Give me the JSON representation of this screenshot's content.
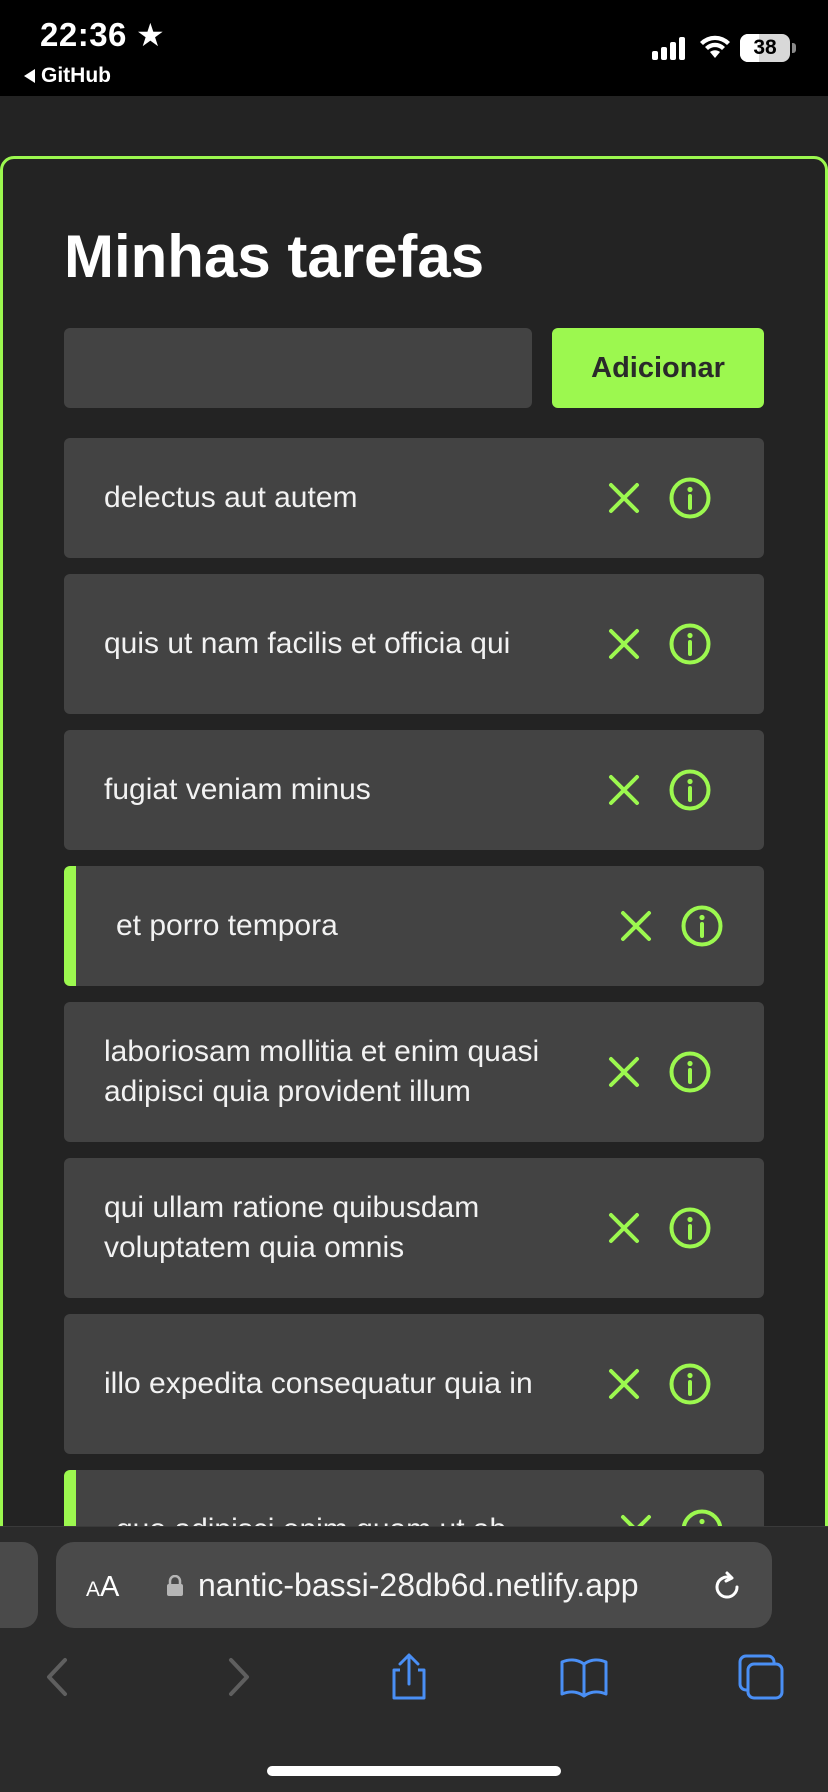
{
  "status_bar": {
    "time": "22:36",
    "back_label": "GitHub",
    "battery": "38"
  },
  "page": {
    "title": "Minhas tarefas",
    "input_placeholder": "",
    "add_button_label": "Adicionar"
  },
  "tasks": [
    {
      "text": "delectus aut autem",
      "active": false
    },
    {
      "text": "quis ut nam facilis et officia qui",
      "active": false
    },
    {
      "text": "fugiat veniam minus",
      "active": false
    },
    {
      "text": "et porro tempora",
      "active": true
    },
    {
      "text": "laboriosam mollitia et enim quasi adipisci quia provident illum",
      "active": false
    },
    {
      "text": "qui ullam ratione quibusdam voluptatem quia omnis",
      "active": false
    },
    {
      "text": "illo expedita consequatur quia in",
      "active": false
    },
    {
      "text": "quo adipisci enim quam ut ab",
      "active": true
    }
  ],
  "browser": {
    "text_size_label": "AA",
    "url": "nantic-bassi-28db6d.netlify.app"
  },
  "colors": {
    "accent": "#9cf84f",
    "background": "#232323",
    "surface": "#434343",
    "browser_blue": "#4a8ff5"
  },
  "icons": {
    "delete": "close-icon",
    "details": "info-icon"
  }
}
